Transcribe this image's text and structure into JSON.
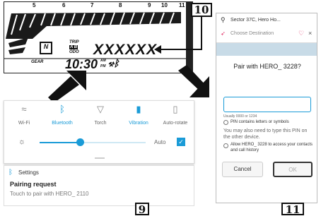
{
  "dashboard": {
    "scale": [
      "5",
      "6",
      "7",
      "8",
      "9",
      "10",
      "11"
    ],
    "odometer": "XXXXXX",
    "trip_top": "TRIP",
    "trip_mid": "A B",
    "trip_bot": "ODO",
    "gear": "GEAR",
    "clock": "10:30",
    "am": "AM",
    "pm": "PM"
  },
  "callouts": {
    "c10": "10",
    "c9": "9",
    "c11": "11"
  },
  "quick_panel": {
    "tiles": [
      {
        "icon": "wifi-icon",
        "glyph": "≈",
        "label": "Wi-Fi",
        "active": false
      },
      {
        "icon": "bluetooth-icon",
        "glyph": "ᛒ",
        "label": "Bluetooth",
        "active": true
      },
      {
        "icon": "torch-icon",
        "glyph": "▽",
        "label": "Torch",
        "active": false
      },
      {
        "icon": "vibration-icon",
        "glyph": "▮",
        "label": "Vibration",
        "active": true
      },
      {
        "icon": "auto-rotate-icon",
        "glyph": "▯",
        "label": "Auto-rotate",
        "active": false
      }
    ],
    "brightness_label": "Auto",
    "brightness_level": 0.38
  },
  "notification": {
    "app": "Settings",
    "title": "Pairing request",
    "body": "Touch to pair with HERO_ 2110"
  },
  "phone": {
    "location": "Sector 37C, Hero Ho...",
    "destination": "Choose Destination",
    "dialog_title": "Pair with HERO_ 3228?",
    "pin_hint": "Usually 0000 or 1234",
    "pin_check": "PIN contains letters or symbols",
    "pin_note": "You may also need to type this PIN on the other device.",
    "allow_check": "Allow HERO_ 3228 to access your contacts and call history",
    "cancel": "Cancel",
    "ok": "OK"
  },
  "colors": {
    "accent": "#1a9bd7",
    "danger": "#e0245e",
    "ok_border": "#333"
  }
}
